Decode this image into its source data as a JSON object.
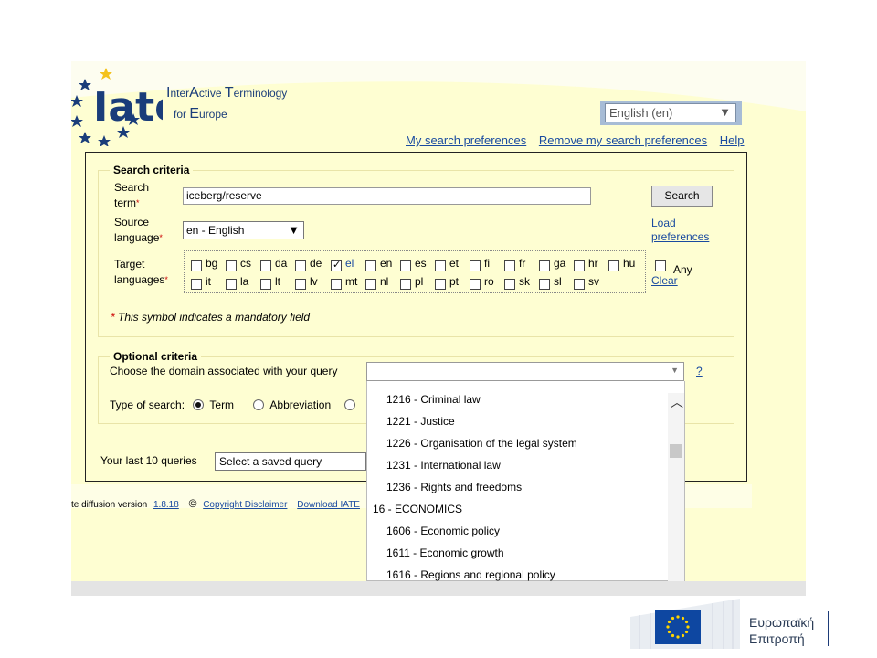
{
  "header": {
    "logo_title_line1": [
      "I",
      "nter",
      "A",
      "ctive ",
      "T",
      "erminology"
    ],
    "logo_title_line2": [
      "for ",
      "E",
      "urope"
    ],
    "language_select": "English (en)",
    "links": [
      "My search preferences",
      "Remove my search preferences",
      "Help"
    ]
  },
  "search_criteria": {
    "legend": "Search criteria",
    "term_label_1": "Search",
    "term_label_2": "term",
    "term_value": "iceberg/reserve",
    "search_button": "Search",
    "source_label_1": "Source",
    "source_label_2": "language",
    "source_value": "en - English",
    "load_prefs_1": "Load",
    "load_prefs_2": "preferences",
    "target_label_1": "Target",
    "target_label_2": "languages",
    "target_row1": [
      {
        "code": "bg",
        "checked": false
      },
      {
        "code": "cs",
        "checked": false
      },
      {
        "code": "da",
        "checked": false
      },
      {
        "code": "de",
        "checked": false
      },
      {
        "code": "el",
        "checked": true
      },
      {
        "code": "en",
        "checked": false
      },
      {
        "code": "es",
        "checked": false
      },
      {
        "code": "et",
        "checked": false
      },
      {
        "code": "fi",
        "checked": false
      },
      {
        "code": "fr",
        "checked": false
      },
      {
        "code": "ga",
        "checked": false
      },
      {
        "code": "hr",
        "checked": false
      },
      {
        "code": "hu",
        "checked": false
      }
    ],
    "target_row2": [
      {
        "code": "it",
        "checked": false
      },
      {
        "code": "la",
        "checked": false
      },
      {
        "code": "lt",
        "checked": false
      },
      {
        "code": "lv",
        "checked": false
      },
      {
        "code": "mt",
        "checked": false
      },
      {
        "code": "nl",
        "checked": false
      },
      {
        "code": "pl",
        "checked": false
      },
      {
        "code": "pt",
        "checked": false
      },
      {
        "code": "ro",
        "checked": false
      },
      {
        "code": "sk",
        "checked": false
      },
      {
        "code": "sl",
        "checked": false
      },
      {
        "code": "sv",
        "checked": false
      }
    ],
    "any_label": "Any",
    "clear_label": "Clear",
    "mandatory_note": "This symbol indicates a mandatory field",
    "asterisk": "*"
  },
  "optional_criteria": {
    "legend": "Optional criteria",
    "domain_label": "Choose the domain associated with your query",
    "domain_value": "",
    "help": "?",
    "type_label": "Type of search:",
    "type_options": [
      {
        "label": "Term",
        "selected": true
      },
      {
        "label": "Abbreviation",
        "selected": false
      }
    ]
  },
  "saved_queries": {
    "label": "Your last 10 queries",
    "select_value": "Select a saved query"
  },
  "domain_list": [
    {
      "text": "1216 - Criminal law",
      "indent": true
    },
    {
      "text": "1221 - Justice",
      "indent": true
    },
    {
      "text": "1226 - Organisation of the legal system",
      "indent": true
    },
    {
      "text": "1231 - International law",
      "indent": true
    },
    {
      "text": "1236 - Rights and freedoms",
      "indent": true
    },
    {
      "text": "16 - ECONOMICS",
      "indent": false
    },
    {
      "text": "1606 - Economic policy",
      "indent": true
    },
    {
      "text": "1611 - Economic growth",
      "indent": true
    },
    {
      "text": "1616 - Regions and regional policy",
      "indent": true
    }
  ],
  "footer": {
    "prefix": "te diffusion version",
    "version": "1.8.18",
    "copyright_symbol": "©",
    "copyright": "Copyright Disclaimer",
    "download": "Download IATE"
  },
  "ec_logo": {
    "line1": "Ευρωπαϊκή",
    "line2": "Επιτροπή"
  },
  "colors": {
    "page_bg": "#fefed2",
    "link": "#1a4ba0",
    "ec_blue": "#0e47a1"
  }
}
